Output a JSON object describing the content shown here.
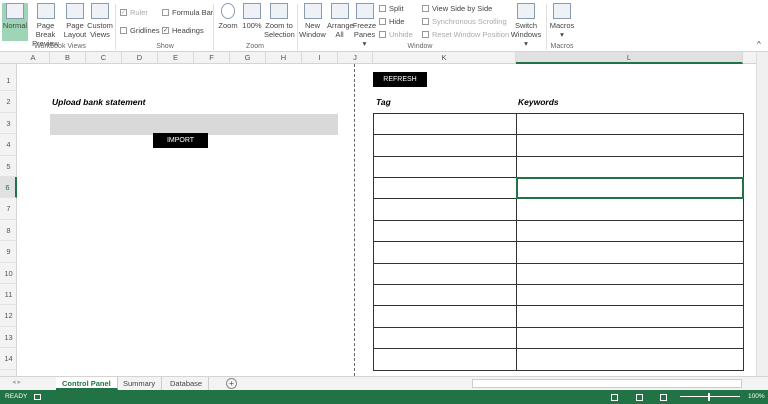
{
  "ribbon": {
    "workbook_views": {
      "label": "Workbook Views",
      "normal": "Normal",
      "page_break": [
        "Page Break",
        "Preview"
      ],
      "page_layout": [
        "Page",
        "Layout"
      ],
      "custom_views": [
        "Custom",
        "Views"
      ]
    },
    "show": {
      "label": "Show",
      "ruler": "Ruler",
      "formula_bar": "Formula Bar",
      "gridlines": "Gridlines",
      "headings": "Headings",
      "ruler_checked": true,
      "formula_bar_checked": false,
      "gridlines_checked": false,
      "headings_checked": true
    },
    "zoom": {
      "label": "Zoom",
      "zoom": "Zoom",
      "hundred": "100%",
      "zoom_sel": [
        "Zoom to",
        "Selection"
      ]
    },
    "window": {
      "label": "Window",
      "new_window": [
        "New",
        "Window"
      ],
      "arrange_all": [
        "Arrange",
        "All"
      ],
      "freeze": [
        "Freeze",
        "Panes ▾"
      ],
      "split": "Split",
      "hide": "Hide",
      "unhide": "Unhide",
      "side_by_side": "View Side by Side",
      "sync_scroll": "Synchronous Scrolling",
      "reset_pos": "Reset Window Position",
      "switch": [
        "Switch",
        "Windows ▾"
      ]
    },
    "macros": {
      "label": "Macros",
      "macros": [
        "Macros",
        "▾"
      ]
    }
  },
  "columns": [
    "A",
    "B",
    "C",
    "D",
    "E",
    "F",
    "G",
    "H",
    "I",
    "J",
    "K",
    "L"
  ],
  "rows": [
    "1",
    "2",
    "3",
    "4",
    "5",
    "6",
    "7",
    "8",
    "9",
    "10",
    "11",
    "12",
    "13",
    "14"
  ],
  "sheet": {
    "upload_label": "Upload bank statement",
    "import_button": "IMPORT",
    "refresh_button": "REFRESH",
    "tag_header": "Tag",
    "keywords_header": "Keywords",
    "selected_cell": "L6"
  },
  "tabs": {
    "items": [
      "Control Panel",
      "Summary",
      "Database"
    ],
    "active": "Control Panel",
    "add": "+"
  },
  "status": {
    "ready": "READY",
    "zoom": "100%"
  },
  "colors": {
    "accent": "#217346"
  }
}
